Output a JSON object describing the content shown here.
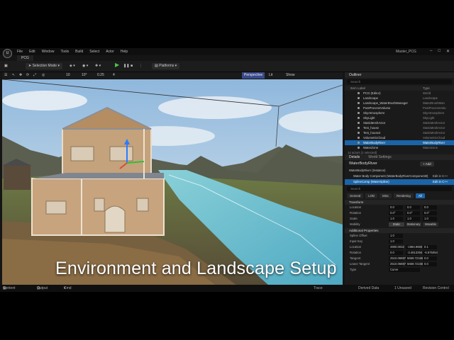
{
  "app": {
    "logo": "U",
    "menu": [
      "File",
      "Edit",
      "Window",
      "Tools",
      "Build",
      "Select",
      "Actor",
      "Help"
    ],
    "window_title": "Master_PCG",
    "project_tab": "PCG"
  },
  "toolbar": {
    "mode": "Selection Mode",
    "platforms": "Platforms"
  },
  "viewport": {
    "perspective": "Perspective",
    "lit": "Lit",
    "show": "Show",
    "grid_snap": "10",
    "rot_snap": "10°",
    "scale_snap": "0.25",
    "speed": "4"
  },
  "outliner": {
    "title": "Outliner",
    "search_placeholder": "Search",
    "col_label": "Item Label",
    "col_type": "Type",
    "rows": [
      {
        "name": "PCG (Editor)",
        "type": "World"
      },
      {
        "name": "Landscape",
        "type": "Landscape"
      },
      {
        "name": "Landscape_WaterBrushManager",
        "type": "WaterBrushMan"
      },
      {
        "name": "PostProcessVolume",
        "type": "PostProcessVolu"
      },
      {
        "name": "SkyAtmosphere",
        "type": "SkyAtmosphere"
      },
      {
        "name": "SkyLight",
        "type": "SkyLight"
      },
      {
        "name": "StaticMeshActor",
        "type": "StaticMeshActor"
      },
      {
        "name": "Test_house",
        "type": "StaticMeshActor"
      },
      {
        "name": "Test_house2",
        "type": "StaticMeshActor"
      },
      {
        "name": "VolumetricCloud",
        "type": "VolumetricCloud"
      },
      {
        "name": "WaterBodyRiver",
        "type": "WaterBodyRiver"
      },
      {
        "name": "WaterZone",
        "type": "WaterZone"
      }
    ],
    "footer": "14 actors (1 selected)"
  },
  "details": {
    "tab_details": "Details",
    "tab_world": "World Settings",
    "actor_name": "WaterBodyRiver",
    "add_label": "+ Add",
    "components": [
      {
        "name": "WaterBodyRiver (Instance)",
        "edit": ""
      },
      {
        "name": "Water Body Component (WaterBodyRiverComponent0)",
        "edit": "Edit in C++"
      },
      {
        "name": "SplineComp (WaterSpline)",
        "edit": "Edit in C++"
      }
    ],
    "search_placeholder": "Search",
    "filters": [
      "General",
      "LOD",
      "Misc",
      "Rendering",
      "All"
    ],
    "sections": {
      "transform": "Transform",
      "mobility_label": "Mobility",
      "water": "Additional Properties"
    },
    "transform": [
      {
        "label": "Location",
        "x": "0.0",
        "y": "0.0",
        "z": "0.0"
      },
      {
        "label": "Rotation",
        "x": "0.0°",
        "y": "0.0°",
        "z": "0.0°"
      },
      {
        "label": "Scale",
        "x": "1.0",
        "y": "1.0",
        "z": "1.0"
      }
    ],
    "mobility": [
      "Static",
      "Stationary",
      "Movable"
    ],
    "props": [
      {
        "label": "Spline Offset",
        "v1": "1.0",
        "v2": "",
        "v3": ""
      },
      {
        "label": "Input Key",
        "v1": "1.0",
        "v2": "",
        "v3": ""
      },
      {
        "label": "Location",
        "v1": "4900.0032",
        "v2": "-1984.9650",
        "v3": "0.1"
      },
      {
        "label": "Rotation",
        "v1": "0.0",
        "v2": "-3.4613294",
        "v3": "-6.875054"
      },
      {
        "label": "Tangent",
        "v1": "2510.06887",
        "v2": "5659.721669",
        "v3": "0.0"
      },
      {
        "label": "Leave Tangent",
        "v1": "2510.06887",
        "v2": "5659.721669",
        "v3": "0.0"
      },
      {
        "label": "Type",
        "v1": "Curve",
        "v2": "",
        "v3": ""
      }
    ]
  },
  "statusbar": {
    "content_drawer": "Content Drawer",
    "output_log": "Output Log",
    "cmd": "Cmd",
    "trace": "Trace",
    "derived_data": "Derived Data",
    "unsaved": "1 Unsaved",
    "revision": "Revision Control"
  },
  "caption": "Environment and Landscape Setup"
}
